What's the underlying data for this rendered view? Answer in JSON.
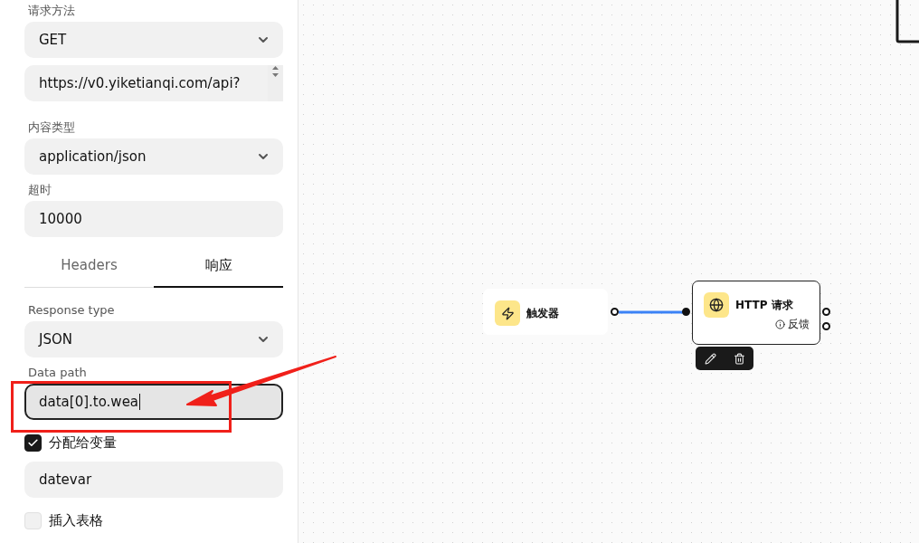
{
  "form": {
    "fields": [
      {
        "kind": "select",
        "label": "请求方法",
        "value": "GET"
      },
      {
        "kind": "textarea",
        "value": "https://v0.yiketianqi.com/api?"
      },
      {
        "kind": "select",
        "label": "内容类型",
        "value": "application/json"
      },
      {
        "kind": "input",
        "label": "超时",
        "value": "10000"
      }
    ],
    "tabs": [
      {
        "label": "Headers",
        "selected": false
      },
      {
        "label": "响应",
        "selected": true
      }
    ],
    "response_fields": [
      {
        "kind": "select",
        "label": "Response type",
        "value": "JSON"
      },
      {
        "kind": "input",
        "label": "Data path",
        "value": "data[0].to.wea",
        "focused": true
      },
      {
        "kind": "checkbox",
        "label": "分配给变量",
        "checked": true
      },
      {
        "kind": "input",
        "value": "datevar"
      },
      {
        "kind": "checkbox",
        "label": "插入表格",
        "checked": false
      }
    ]
  },
  "canvas": {
    "nodes": [
      {
        "kind": "trigger",
        "title": "触发器",
        "selected": false
      },
      {
        "kind": "http",
        "title": "HTTP 请求",
        "feedback": "反馈",
        "selected": true
      }
    ]
  }
}
